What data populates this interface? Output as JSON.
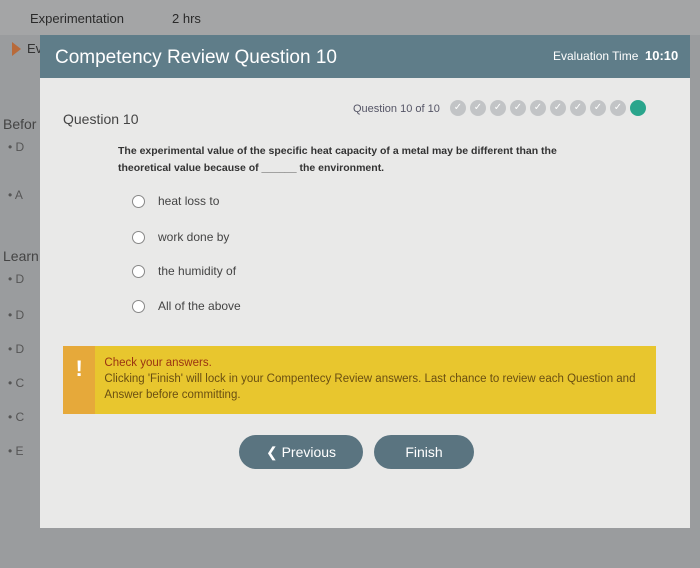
{
  "background": {
    "course": "Experimentation",
    "duration": "2 hrs",
    "ev": "Ev",
    "sections": [
      "Befor",
      "Learn"
    ],
    "bullets_before": [
      "D",
      "A"
    ],
    "bullets_learn": [
      "D",
      "D",
      "D",
      "C",
      "C",
      "E"
    ]
  },
  "modal": {
    "title": "Competency Review Question 10",
    "eval_label": "Evaluation Time",
    "eval_time": "10:10"
  },
  "question": {
    "label": "Question 10",
    "progress": "Question 10 of 10",
    "total": 10,
    "current": 10,
    "text": "The experimental value of the specific heat capacity of a metal may be different than the theoretical value because of ______ the environment.",
    "options": [
      "heat loss to",
      "work done by",
      "the humidity of",
      "All of the above"
    ]
  },
  "alert": {
    "icon": "exclamation-icon",
    "title": "Check your answers.",
    "body": "Clicking 'Finish' will lock in your Compentecy Review answers. Last chance to review each Question and Answer before committing."
  },
  "buttons": {
    "previous": "Previous",
    "finish": "Finish"
  },
  "colors": {
    "header": "#5f7d89",
    "current": "#2aa58c",
    "alert": "#e8c62e"
  }
}
